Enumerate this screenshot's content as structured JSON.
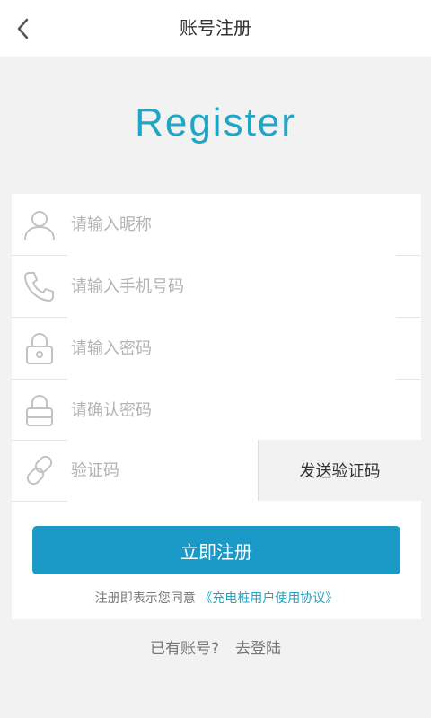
{
  "header": {
    "title": "账号注册"
  },
  "brand": {
    "title": "Register",
    "accent_color": "#1ea6c6"
  },
  "fields": [
    {
      "placeholder": "请输入昵称",
      "icon": "user-icon"
    },
    {
      "placeholder": "请输入手机号码",
      "icon": "phone-icon"
    },
    {
      "placeholder": "请输入密码",
      "icon": "lock-icon"
    },
    {
      "placeholder": "请确认密码",
      "icon": "lock-confirm-icon"
    },
    {
      "placeholder": "验证码",
      "icon": "link-icon"
    }
  ],
  "send_code": {
    "label": "发送验证码"
  },
  "submit": {
    "label": "立即注册",
    "color": "#1b9ac8"
  },
  "agreement": {
    "prefix": "注册即表示您同意",
    "link": "《充电桩用户使用协议》"
  },
  "footer": {
    "question": "已有账号?",
    "login": "去登陆"
  }
}
